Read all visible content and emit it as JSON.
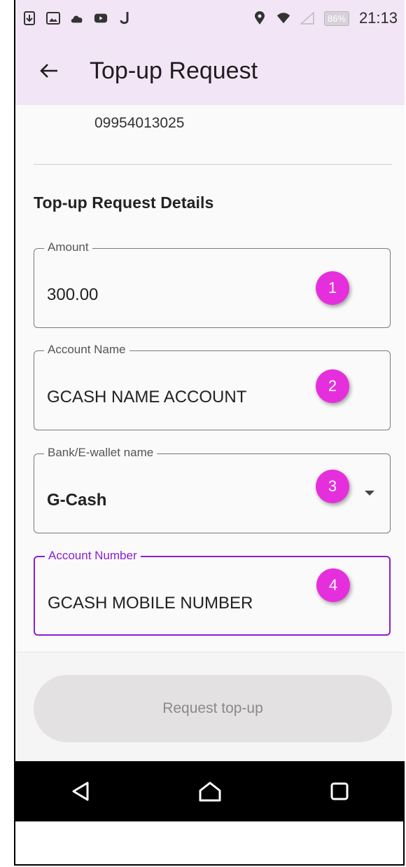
{
  "status_bar": {
    "battery": "86%",
    "time": "21:13"
  },
  "app_bar": {
    "title": "Top-up Request"
  },
  "content": {
    "mobile_number": "09954013025",
    "section_title": "Top-up Request Details",
    "fields": [
      {
        "label": "Amount",
        "value": "300.00",
        "badge": "1"
      },
      {
        "label": "Account Name",
        "value": "GCASH NAME ACCOUNT",
        "badge": "2"
      },
      {
        "label": "Bank/E-wallet name",
        "value": "G-Cash",
        "badge": "3"
      },
      {
        "label": "Account Number",
        "value": "GCASH MOBILE NUMBER",
        "badge": "4"
      }
    ]
  },
  "actions": {
    "submit_label": "Request top-up"
  },
  "colors": {
    "header_bg": "#f2e6f6",
    "accent": "#8a1fd1",
    "badge": "#e62fdc"
  }
}
